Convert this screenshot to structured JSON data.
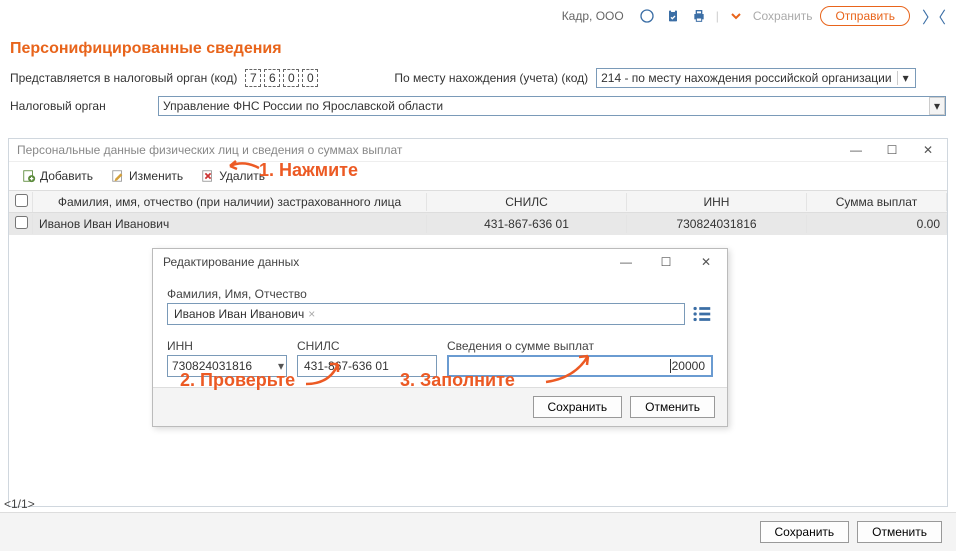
{
  "topbar": {
    "org": "Кадр, ООО",
    "save": "Сохранить",
    "send": "Отправить"
  },
  "title": "Персонифицированные сведения",
  "row1": {
    "label1": "Представляется в налоговый орган (код)",
    "code": [
      "7",
      "6",
      "0",
      "0"
    ],
    "label2": "По месту нахождения (учета) (код)",
    "select": "214 - по месту нахождения российской организации"
  },
  "row2": {
    "label": "Налоговый орган",
    "value": "Управление ФНС России по Ярославской области"
  },
  "subwin": {
    "title": "Персональные данные физических лиц и сведения о суммах выплат",
    "toolbar": {
      "add": "Добавить",
      "edit": "Изменить",
      "del": "Удалить"
    },
    "cols": {
      "fio": "Фамилия, имя, отчество (при наличии) застрахованного лица",
      "snils": "СНИЛС",
      "inn": "ИНН",
      "sum": "Сумма выплат"
    },
    "rows": [
      {
        "fio": "Иванов Иван Иванович",
        "snils": "431-867-636 01",
        "inn": "730824031816",
        "sum": "0.00"
      }
    ]
  },
  "modal": {
    "title": "Редактирование данных",
    "fioLabel": "Фамилия, Имя, Отчество",
    "fio": "Иванов Иван Иванович",
    "innLabel": "ИНН",
    "inn": "730824031816",
    "snilsLabel": "СНИЛС",
    "snils": "431-867-636 01",
    "sumLabel": "Сведения о сумме выплат",
    "sum": "20000",
    "save": "Сохранить",
    "cancel": "Отменить"
  },
  "annotations": {
    "a1": "1. Нажмите",
    "a2": "2. Проверьте",
    "a3": "3. Заполните"
  },
  "pager": "<1/1>",
  "footer": {
    "save": "Сохранить",
    "cancel": "Отменить"
  }
}
